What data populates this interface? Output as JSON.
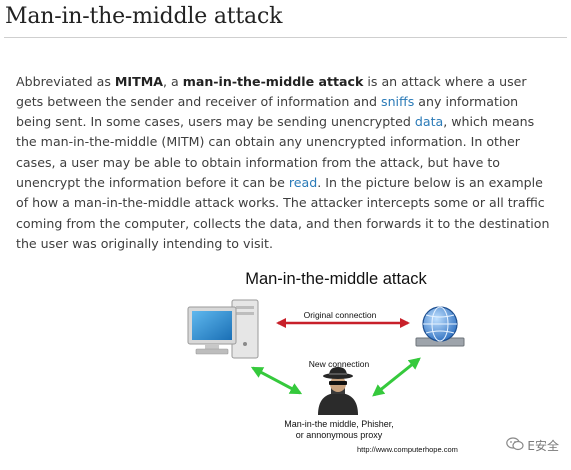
{
  "page": {
    "title": "Man-in-the-middle attack"
  },
  "article": {
    "p_abbrev": "Abbreviated as ",
    "abbr": "MITMA",
    "p_comma": ", a ",
    "term": "man-in-the-middle attack",
    "p_1": " is an attack where a user gets between the sender and receiver of information and ",
    "link_sniffs": "sniffs",
    "p_2": " any information being sent. In some cases, users may be sending unencrypted ",
    "link_data": "data",
    "p_3": ", which means the man-in-the-middle (MITM) can obtain any unencrypted information. In other cases, a user may be able to obtain information from the attack, but have to unencrypt the information before it can be ",
    "link_read": "read",
    "p_4": ". In the picture below is an example of how a man-in-the-middle attack works. The attacker intercepts some or all traffic coming from the computer, collects the data, and then forwards it to the destination the user was originally intending to visit."
  },
  "figure": {
    "title": "Man-in-the-middle attack",
    "original_label": "Original connection",
    "new_label": "New connection",
    "attacker_line1": "Man-in-the middle, Phisher,",
    "attacker_line2": "or annonymous proxy",
    "source_url": "http://www.computerhope.com",
    "colors": {
      "red_arrow": "#c8202a",
      "green_arrow": "#35c93c"
    }
  },
  "watermark": {
    "text": "E安全",
    "icon": "wechat-icon"
  }
}
